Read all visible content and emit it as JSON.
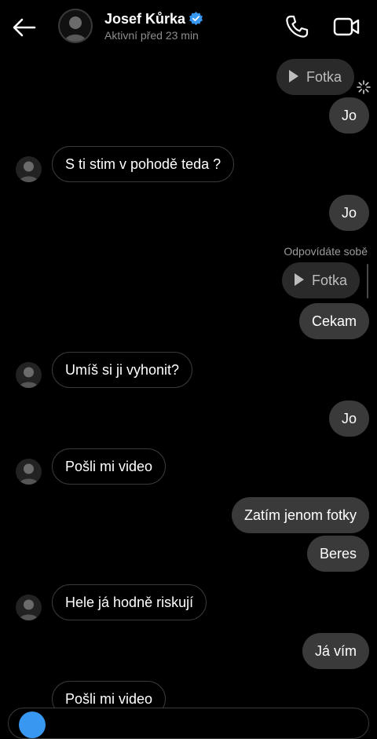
{
  "header": {
    "name": "Josef Kůrka",
    "status": "Aktivní před 23 min"
  },
  "colors": {
    "background": "#000000",
    "outgoing_bubble": "#3a3a3a",
    "verified": "#3897f0"
  },
  "messages": [
    {
      "dir": "out",
      "type": "photo",
      "text": "Fotka"
    },
    {
      "dir": "out",
      "text": "Jo"
    },
    {
      "dir": "in",
      "text": "S ti stim v pohodě teda ?"
    },
    {
      "dir": "out",
      "text": "Jo"
    },
    {
      "dir": "out",
      "type": "photo",
      "reply_label": "Odpovídáte sobě",
      "text": "Fotka"
    },
    {
      "dir": "out",
      "text": "Cekam"
    },
    {
      "dir": "in",
      "text": "Umíš si ji vyhonit?"
    },
    {
      "dir": "out",
      "text": "Jo"
    },
    {
      "dir": "in",
      "text": "Pošli mi video"
    },
    {
      "dir": "out",
      "text": "Zatím jenom fotky"
    },
    {
      "dir": "out",
      "text": "Beres"
    },
    {
      "dir": "in",
      "text": "Hele já hodně riskují"
    },
    {
      "dir": "out",
      "text": "Já vím"
    },
    {
      "dir": "in",
      "text": "Pošli mi video"
    }
  ]
}
